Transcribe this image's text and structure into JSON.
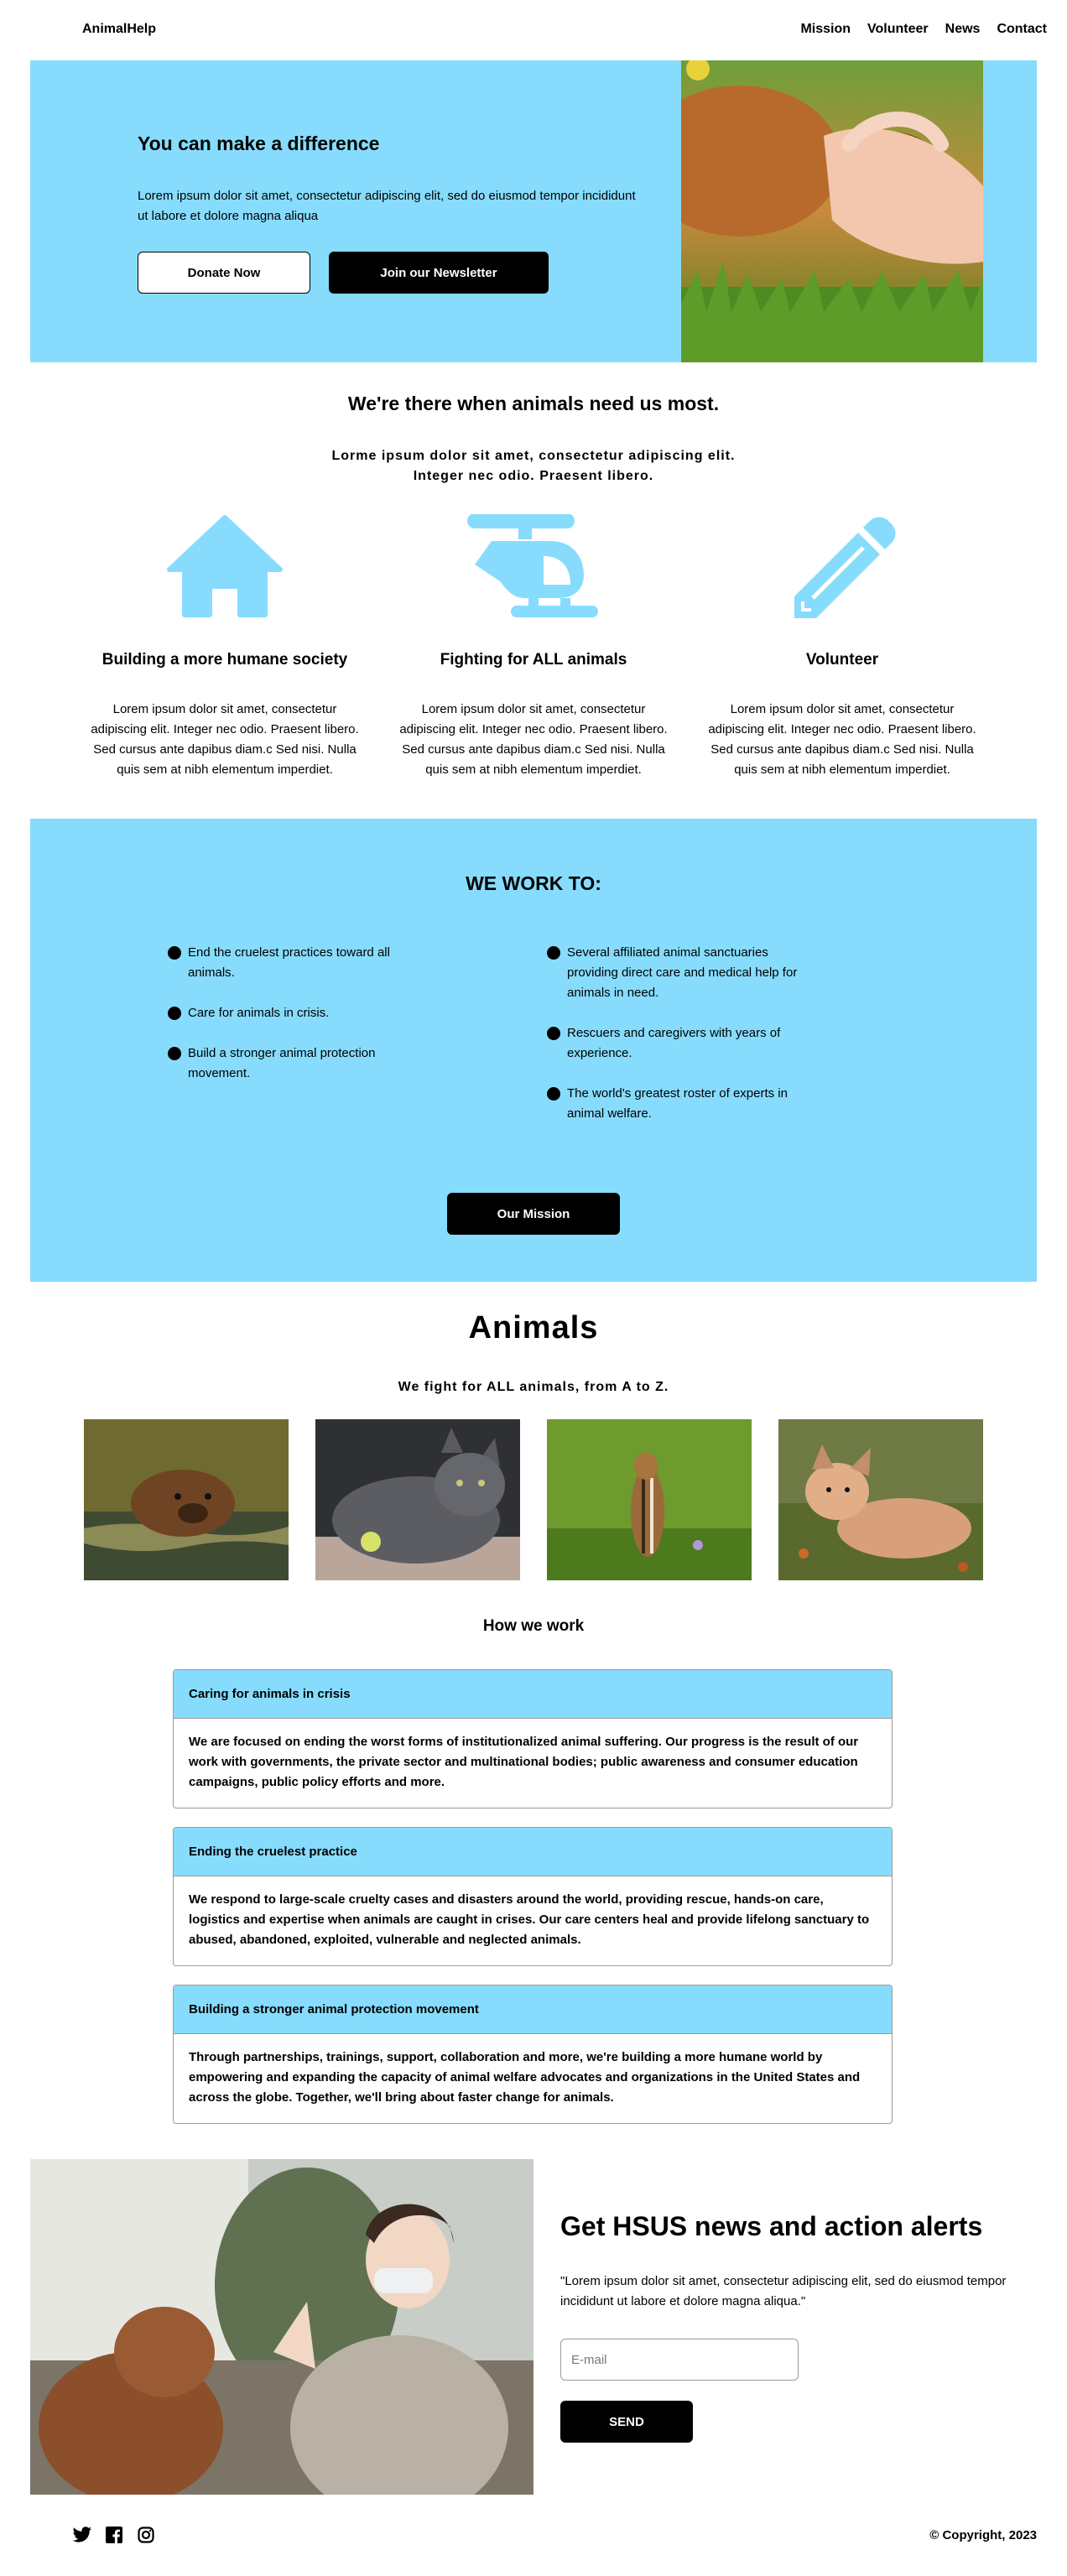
{
  "nav": {
    "logo": "AnimalHelp",
    "links": [
      "Mission",
      "Volunteer",
      "News",
      "Contact"
    ]
  },
  "hero": {
    "title": "You can make a difference",
    "text": "Lorem ipsum dolor sit amet, consectetur adipiscing elit, sed do eiusmod tempor incididunt ut labore et dolore magna aliqua",
    "donate_label": "Donate Now",
    "newsletter_label": "Join our Newsletter"
  },
  "intro": {
    "title": "We're there when animals need us most.",
    "subtitle_line1": "Lorme ipsum dolor sit amet, consectetur adipiscing elit.",
    "subtitle_line2": "Integer nec odio. Praesent libero."
  },
  "features": [
    {
      "icon": "house-icon",
      "title": "Building a more humane society",
      "text": "Lorem ipsum dolor sit amet, consectetur adipiscing elit. Integer nec odio. Praesent libero. Sed cursus ante dapibus diam.c Sed nisi. Nulla quis sem at nibh elementum imperdiet."
    },
    {
      "icon": "helicopter-icon",
      "title": "Fighting for ALL animals",
      "text": "Lorem ipsum dolor sit amet, consectetur adipiscing elit. Integer nec odio. Praesent libero. Sed cursus ante dapibus diam.c Sed nisi. Nulla quis sem at nibh elementum imperdiet."
    },
    {
      "icon": "pencil-icon",
      "title": "Volunteer",
      "text": "Lorem ipsum dolor sit amet, consectetur adipiscing elit. Integer nec odio. Praesent libero. Sed cursus ante dapibus diam.c Sed nisi. Nulla quis sem at nibh elementum imperdiet."
    }
  ],
  "work": {
    "title": "WE WORK TO:",
    "left": [
      "End the cruelest practices toward all animals.",
      "Care for animals in crisis.",
      "Build a stronger animal protection movement."
    ],
    "right": [
      "Several affiliated animal sanctuaries providing direct care and medical help for animals in need.",
      "Rescuers and caregivers with years of experience.",
      "The world's greatest roster of experts in animal welfare."
    ],
    "button_label": "Our Mission"
  },
  "animals": {
    "title": "Animals",
    "subtitle": "We fight for ALL animals, from A to Z."
  },
  "how": {
    "title": "How we work",
    "items": [
      {
        "heading": "Caring for animals in crisis",
        "body": "We are focused on ending the worst forms of institutionalized animal suffering. Our progress is the result of our work with governments, the private sector and multinational bodies; public awareness and consumer education campaigns, public policy efforts and more."
      },
      {
        "heading": "Ending the cruelest practice",
        "body": "We respond to large-scale cruelty cases and disasters around the world, providing rescue, hands-on care, logistics and expertise when animals are caught in crises. Our care centers heal and provide lifelong sanctuary to abused, abandoned, exploited, vulnerable and neglected animals."
      },
      {
        "heading": "Building a stronger animal protection movement",
        "body": "Through partnerships, trainings, support, collaboration and more, we're building a more humane world by empowering and expanding the capacity of animal welfare advocates and organizations in the United States and across the globe. Together, we'll bring about faster change for animals."
      }
    ]
  },
  "news": {
    "title": "Get HSUS news and action alerts",
    "text": "\"Lorem ipsum dolor sit amet, consectetur adipiscing elit, sed do eiusmod tempor incididunt ut labore et dolore magna aliqua.\"",
    "email_placeholder": "E-mail",
    "send_label": "SEND"
  },
  "footer": {
    "social": [
      "twitter-icon",
      "facebook-icon",
      "instagram-icon"
    ],
    "copyright": "© Copyright, 2023"
  },
  "colors": {
    "accent": "#87dcfd",
    "dark": "#000000",
    "border": "#9a9a9a"
  }
}
